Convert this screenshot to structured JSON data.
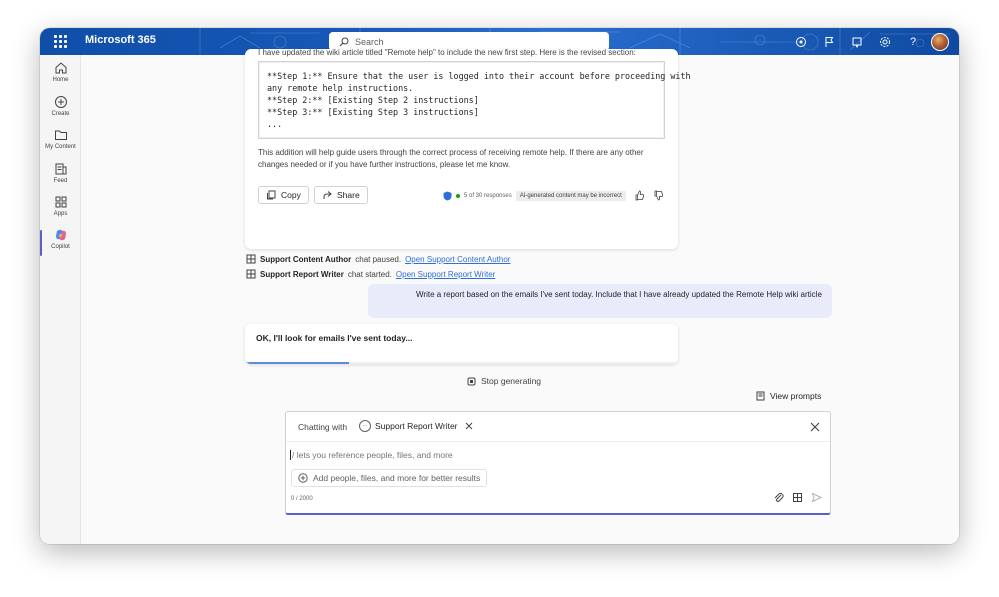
{
  "app": {
    "brand": "Microsoft 365"
  },
  "search": {
    "placeholder": "Search"
  },
  "rail": {
    "items": [
      {
        "label": "Home"
      },
      {
        "label": "Create"
      },
      {
        "label": "My Content"
      },
      {
        "label": "Feed"
      },
      {
        "label": "Apps"
      },
      {
        "label": "Copilot"
      }
    ]
  },
  "response": {
    "cut_line": "I have updated the wiki article titled \"Remote help\" to include the new first step. Here is the revised section:",
    "code_lines": [
      "**Step 1:** Ensure that the user is logged into their account before proceeding with",
      "any remote help instructions.",
      "**Step 2:** [Existing Step 2 instructions]",
      "**Step 3:** [Existing Step 3 instructions]",
      "..."
    ],
    "body": "This addition will help guide users through the correct process of receiving remote help. If there are any other changes needed or if you have further instructions, please let me know.",
    "copy_label": "Copy",
    "share_label": "Share",
    "responses": "5 of 30 responses",
    "ai_notice": "AI-generated content may be incorrect"
  },
  "status": {
    "line1": {
      "agent": "Support Content Author",
      "text": "chat paused.",
      "link": "Open Support Content Author"
    },
    "line2": {
      "agent": "Support Report Writer",
      "text": "chat started.",
      "link": "Open Support Report Writer"
    }
  },
  "user_message": "Write a report based on the emails I've sent today. Include that I have already updated the Remote Help wiki article",
  "assistant_pending": {
    "text": "OK, I'll look for emails I've sent today...",
    "progress": 0.24
  },
  "stop_label": "Stop generating",
  "view_prompts_label": "View prompts",
  "composer": {
    "chatting_with": "Chatting with",
    "agent": "Support Report Writer",
    "input_placeholder": "/ lets you reference people, files, and more",
    "add_label": "Add people, files, and more for better results",
    "counter": "0 / 2000"
  },
  "colors": {
    "accent": "#5b5fc7",
    "user_bubble": "#e8ebfa",
    "link": "#2f6fd6"
  }
}
